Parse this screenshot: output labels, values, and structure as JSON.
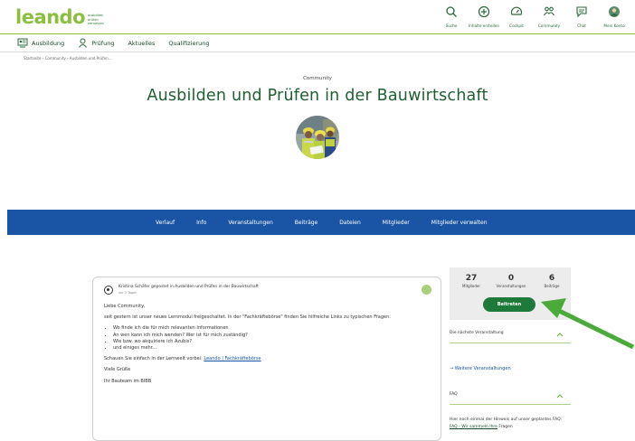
{
  "brand": {
    "name": "leando",
    "tagline": [
      "ausbilden",
      "prüfen",
      "vernetzen"
    ],
    "accent": "#8cbf3f",
    "dark_green": "#1f5f30",
    "blue": "#1a55a5"
  },
  "top_actions": [
    {
      "label": "Suche",
      "icon": "search-icon"
    },
    {
      "label": "Inhalte erstellen",
      "icon": "add-content-icon"
    },
    {
      "label": "Cockpit",
      "icon": "cockpit-icon"
    },
    {
      "label": "Community",
      "icon": "community-icon"
    },
    {
      "label": "Chat",
      "icon": "chat-icon"
    },
    {
      "label": "Mein Konto",
      "icon": "account-icon"
    }
  ],
  "main_nav": [
    {
      "label": "Ausbildung",
      "icon": "ausbildung-icon"
    },
    {
      "label": "Prüfung",
      "icon": "pruefung-icon"
    },
    {
      "label": "Aktuelles"
    },
    {
      "label": "Qualifizierung"
    }
  ],
  "breadcrumb": "Startseite › Community › Ausbilden und Prüfen...",
  "community_label": "Community",
  "page_title": "Ausbilden und Prüfen in der Bauwirtschaft",
  "tabs": [
    "Verlauf",
    "Info",
    "Veranstaltungen",
    "Beiträge",
    "Dateien",
    "Mitglieder",
    "Mitglieder verwalten"
  ],
  "post": {
    "author_line": "Kristina Schäfer gepostet in Ausbilden und Prüfen in der Bauwirtschaft",
    "time": "vor 3 Tagen",
    "greeting": "Liebe Community,",
    "intro": "seit gestern ist unser neues Lernmodul freigeschaltet. In der \"Fachkräftebörse\" finden Sie hilfreiche Links zu typischen Fragen:",
    "bullets": [
      "Wo finde ich die für mich relevanten Informationen",
      "An wen kann ich mich wenden? Wer ist für mich zuständig?",
      "Wie bzw. wo akquiriere ich Azubis?",
      "und einiges mehr..."
    ],
    "link_prefix": "Schauen Sie einfach in der Lernwelt vorbei: ",
    "link_text": "Leando | Fachkräftebörse",
    "closing": "Viele Grüße",
    "signature": "Ihr Bauteam im BIBB"
  },
  "stats": [
    {
      "value": "27",
      "label": "Mitglieder"
    },
    {
      "value": "0",
      "label": "Veranstaltungen"
    },
    {
      "value": "6",
      "label": "Beiträge"
    }
  ],
  "join_label": "Beitreten",
  "next_event_title": "Die nächste Veranstaltung",
  "more_events": "→ Weitere Veranstaltungen",
  "faq_title": "FAQ",
  "faq_text_prefix": "Hier noch einmal der Hinweis auf unser geplantes FAQ: ",
  "faq_link": "FAQ - Wir sammeln Ihre",
  "faq_text_suffix": " Fragen"
}
